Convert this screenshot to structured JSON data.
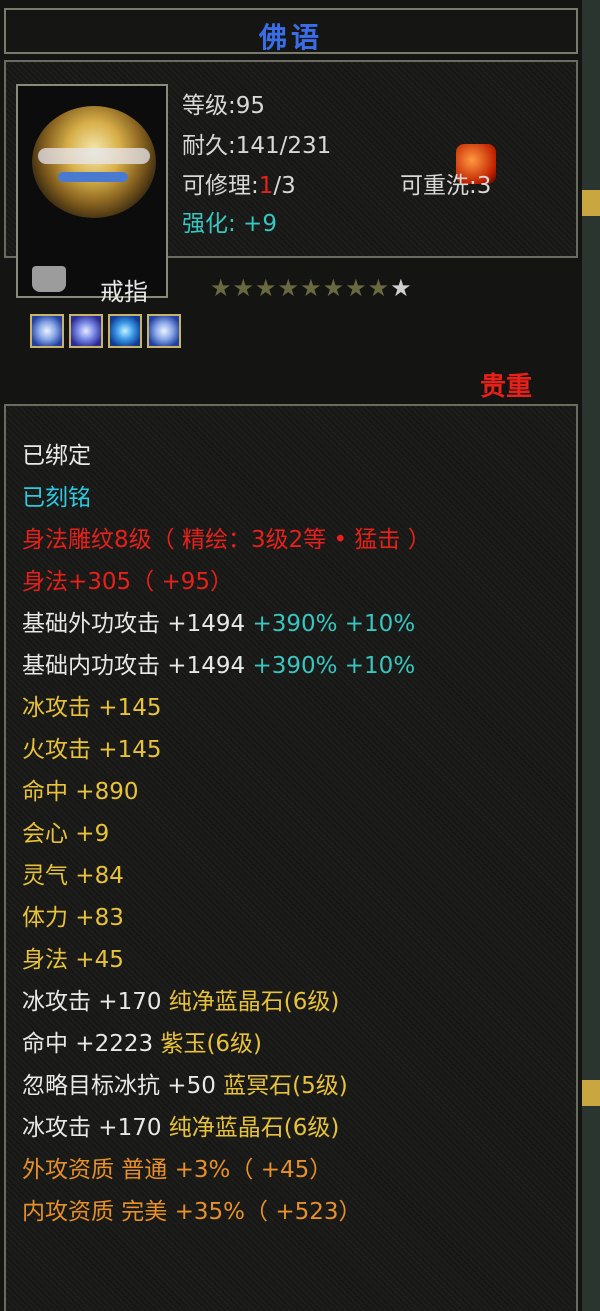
{
  "colors": {
    "white": "#e8e8e8",
    "cyan": "#2ec8e0",
    "red": "#e8201a",
    "yellow": "#e8c23a",
    "orange": "#e8902a",
    "teal": "#38c6c0",
    "title": "#3a6ee8"
  },
  "title": "佛语",
  "header": {
    "level": "等级:95",
    "durability": "耐久:141/231",
    "repair_prefix": "可修理:",
    "repair_num": "1",
    "repair_suffix": "/3",
    "rewash": "可重洗:3",
    "enhance": "强化: +9"
  },
  "item": {
    "name": "戒指",
    "stars_total": 9,
    "stars_filled": 8,
    "gems": [
      "gem-icon",
      "gem-icon",
      "gem-icon",
      "gem-icon"
    ],
    "rarity": "贵重"
  },
  "attributes": {
    "bound": "已绑定",
    "engraved": "已刻铭",
    "carving": "身法雕纹8级（ 精绘：3级2等 • 猛击 ）",
    "agility_main": "身法+305（ +95）",
    "base_outer_label": "基础外功攻击 +1494 ",
    "base_outer_pct": "+390% +10%",
    "base_inner_label": "基础内功攻击 +1494 ",
    "base_inner_pct": "+390% +10%",
    "ice_atk": "冰攻击 +145",
    "fire_atk": "火攻击 +145",
    "hit": "命中 +890",
    "crit": "会心 +9",
    "spirit": "灵气 +84",
    "stamina": "体力 +83",
    "agility": "身法 +45",
    "gem1_stat": "冰攻击 +170 ",
    "gem1_name": "纯净蓝晶石(6级)",
    "gem2_stat": "命中 +2223 ",
    "gem2_name": "紫玉(6级)",
    "gem3_stat": "忽略目标冰抗 +50 ",
    "gem3_name": "蓝冥石(5级)",
    "gem4_stat": "冰攻击 +170 ",
    "gem4_name": "纯净蓝晶石(6级)",
    "outer_quality": "外攻资质  普通 +3%（ +45）",
    "inner_quality": "内攻资质  完美 +35%（ +523）"
  }
}
